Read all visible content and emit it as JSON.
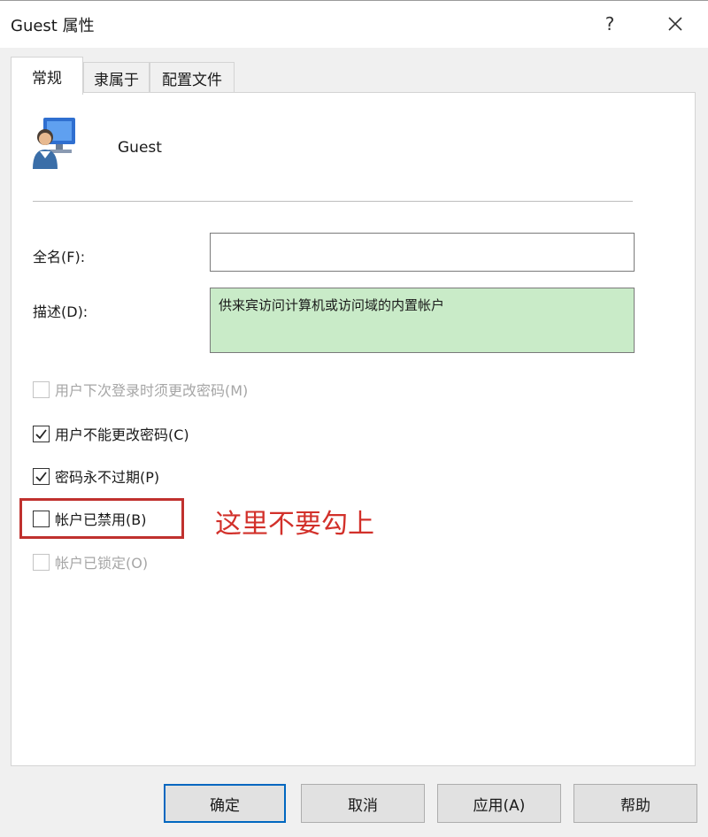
{
  "window": {
    "title": "Guest 属性",
    "help_label": "?"
  },
  "tabs": [
    {
      "label": "常规",
      "active": true
    },
    {
      "label": "隶属于",
      "active": false
    },
    {
      "label": "配置文件",
      "active": false
    }
  ],
  "general": {
    "user_name": "Guest",
    "fullname_label": "全名(F):",
    "fullname_value": "",
    "description_label": "描述(D):",
    "description_value": "供来宾访问计算机或访问域的内置帐户",
    "checkboxes": [
      {
        "label": "用户下次登录时须更改密码(M)",
        "checked": false,
        "enabled": false
      },
      {
        "label": "用户不能更改密码(C)",
        "checked": true,
        "enabled": true
      },
      {
        "label": "密码永不过期(P)",
        "checked": true,
        "enabled": true
      },
      {
        "label": "帐户已禁用(B)",
        "checked": false,
        "enabled": true
      },
      {
        "label": "帐户已锁定(O)",
        "checked": false,
        "enabled": false
      }
    ]
  },
  "annotation": {
    "text": "这里不要勾上",
    "color": "#d2302a"
  },
  "buttons": {
    "ok": "确定",
    "cancel": "取消",
    "apply": "应用(A)",
    "help": "帮助"
  },
  "colors": {
    "description_bg": "#c9ebc8",
    "default_button_border": "#0067c0",
    "highlight_border": "#c0312e"
  },
  "icons": {
    "user": "user-computer-icon",
    "close": "close-icon",
    "check": "checkmark-icon"
  }
}
